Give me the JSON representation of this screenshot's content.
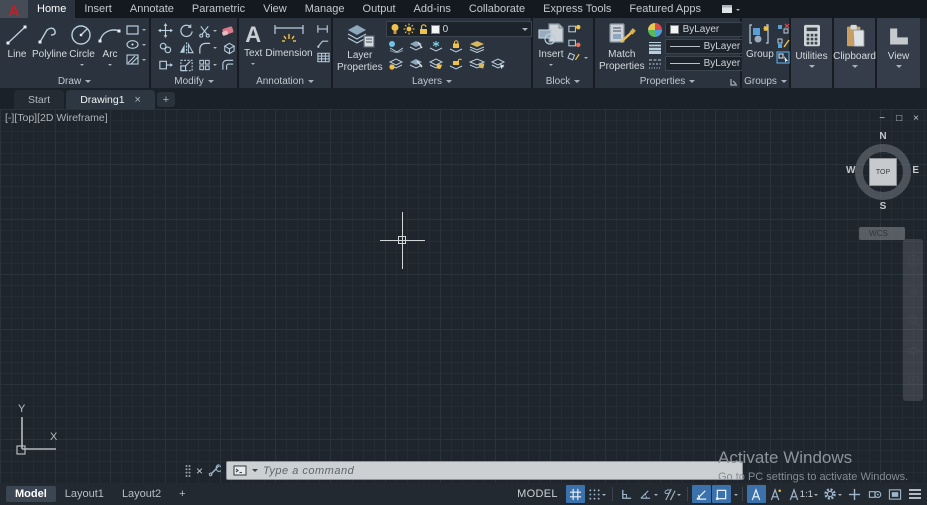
{
  "app": {
    "logo_letter": "A"
  },
  "tabs": [
    "Home",
    "Insert",
    "Annotate",
    "Parametric",
    "View",
    "Manage",
    "Output",
    "Add-ins",
    "Collaborate",
    "Express Tools",
    "Featured Apps"
  ],
  "panels": {
    "draw": {
      "label": "Draw",
      "line": "Line",
      "polyline": "Polyline",
      "circle": "Circle",
      "arc": "Arc"
    },
    "modify": {
      "label": "Modify"
    },
    "annotation": {
      "label": "Annotation",
      "text": "Text",
      "text_glyph": "A",
      "dimension": "Dimension"
    },
    "layers": {
      "label": "Layers",
      "layer_properties_line1": "Layer",
      "layer_properties_line2": "Properties",
      "current_layer": "0"
    },
    "block": {
      "label": "Block",
      "insert": "Insert"
    },
    "properties": {
      "label": "Properties",
      "match_line1": "Match",
      "match_line2": "Properties",
      "object_color": "ByLayer",
      "lineweight": "ByLayer",
      "linetype": "ByLayer"
    },
    "groups": {
      "label": "Groups",
      "group": "Group"
    },
    "utilities": {
      "label": "Utilities"
    },
    "clipboard": {
      "label": "Clipboard"
    },
    "view": {
      "label": "View"
    }
  },
  "file_tabs": {
    "start": "Start",
    "drawing1": "Drawing1",
    "close_glyph": "×",
    "new_tab_glyph": "+"
  },
  "viewport": {
    "view_label": "[-][Top][2D Wireframe]",
    "controls": {
      "minimize": "−",
      "restore": "□",
      "close": "×"
    },
    "viewcube": {
      "north": "N",
      "south": "S",
      "east": "E",
      "west": "W",
      "face": "TOP",
      "wcs_label": "WCS"
    },
    "ucs": {
      "x_label": "X",
      "y_label": "Y"
    }
  },
  "command_line": {
    "close_glyph": "×",
    "placeholder": "Type a command"
  },
  "status_bar": {
    "layout_tabs": {
      "model": "Model",
      "layout1": "Layout1",
      "layout2": "Layout2",
      "add": "+"
    },
    "space_label": "MODEL",
    "annotation_scale": "1:1"
  },
  "watermark": {
    "title": "Activate Windows",
    "subtitle": "Go to PC settings to activate Windows."
  },
  "colors": {
    "status_active_blue": "#3c72ab",
    "icon_yellow": "#f0c24b",
    "ribbon_bg": "#2a333e",
    "canvas_bg": "#1f252c"
  }
}
